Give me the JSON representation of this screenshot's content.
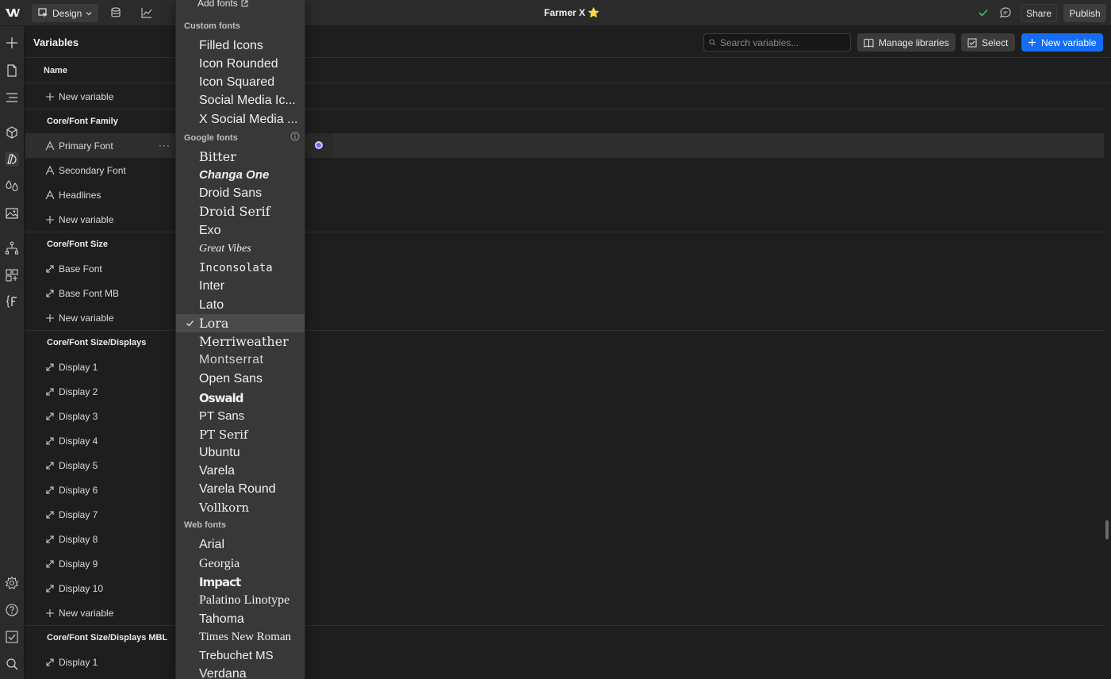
{
  "topbar": {
    "mode_label": "Design",
    "project_title": "Farmer X ⭐",
    "share_label": "Share",
    "publish_label": "Publish"
  },
  "panel": {
    "title": "Variables",
    "search_placeholder": "Search variables...",
    "manage_libraries_label": "Manage libraries",
    "select_label": "Select",
    "new_variable_label": "New variable",
    "column_name": "Name"
  },
  "rows": [
    {
      "type": "item",
      "icon": "plus-icon",
      "label": "New variable"
    },
    {
      "type": "group",
      "label": "Core/Font Family"
    },
    {
      "type": "item",
      "icon": "font-icon",
      "label": "Primary Font",
      "selected": true
    },
    {
      "type": "item",
      "icon": "font-icon",
      "label": "Secondary Font"
    },
    {
      "type": "item",
      "icon": "font-icon",
      "label": "Headlines"
    },
    {
      "type": "item",
      "icon": "plus-icon",
      "label": "New variable"
    },
    {
      "type": "group",
      "label": "Core/Font Size"
    },
    {
      "type": "item",
      "icon": "resize-icon",
      "label": "Base Font"
    },
    {
      "type": "item",
      "icon": "resize-icon",
      "label": "Base Font MB"
    },
    {
      "type": "item",
      "icon": "plus-icon",
      "label": "New variable"
    },
    {
      "type": "group",
      "label": "Core/Font Size/Displays"
    },
    {
      "type": "item",
      "icon": "resize-icon",
      "label": "Display 1"
    },
    {
      "type": "item",
      "icon": "resize-icon",
      "label": "Display 2"
    },
    {
      "type": "item",
      "icon": "resize-icon",
      "label": "Display 3"
    },
    {
      "type": "item",
      "icon": "resize-icon",
      "label": "Display 4"
    },
    {
      "type": "item",
      "icon": "resize-icon",
      "label": "Display 5"
    },
    {
      "type": "item",
      "icon": "resize-icon",
      "label": "Display 6"
    },
    {
      "type": "item",
      "icon": "resize-icon",
      "label": "Display 7"
    },
    {
      "type": "item",
      "icon": "resize-icon",
      "label": "Display 8"
    },
    {
      "type": "item",
      "icon": "resize-icon",
      "label": "Display 9"
    },
    {
      "type": "item",
      "icon": "resize-icon",
      "label": "Display 10"
    },
    {
      "type": "item",
      "icon": "plus-icon",
      "label": "New variable"
    },
    {
      "type": "group",
      "label": "Core/Font Size/Displays MBL"
    },
    {
      "type": "item",
      "icon": "resize-icon",
      "label": "Display 1"
    }
  ],
  "dropdown": {
    "add_fonts_label": "Add fonts",
    "custom_section": "Custom fonts",
    "custom_fonts": [
      "Filled Icons",
      "Icon Rounded",
      "Icon Squared",
      "Social Media Ic...",
      "X Social Media ..."
    ],
    "google_section": "Google fonts",
    "google_fonts": [
      "Bitter",
      "Changa One",
      "Droid Sans",
      "Droid Serif",
      "Exo",
      "Great Vibes",
      "Inconsolata",
      "Inter",
      "Lato",
      "Lora",
      "Merriweather",
      "Montserrat",
      "Open Sans",
      "Oswald",
      "PT Sans",
      "PT Serif",
      "Ubuntu",
      "Varela",
      "Varela Round",
      "Vollkorn"
    ],
    "selected_font": "Lora",
    "web_section": "Web fonts",
    "web_fonts": [
      "Arial",
      "Georgia",
      "Impact",
      "Palatino Linotype",
      "Tahoma",
      "Times New Roman",
      "Trebuchet MS",
      "Verdana"
    ]
  },
  "colors": {
    "accent": "#146ef5",
    "selected_dot": "#7b61ff",
    "success": "#3ec46d",
    "star": "#f5c518"
  }
}
